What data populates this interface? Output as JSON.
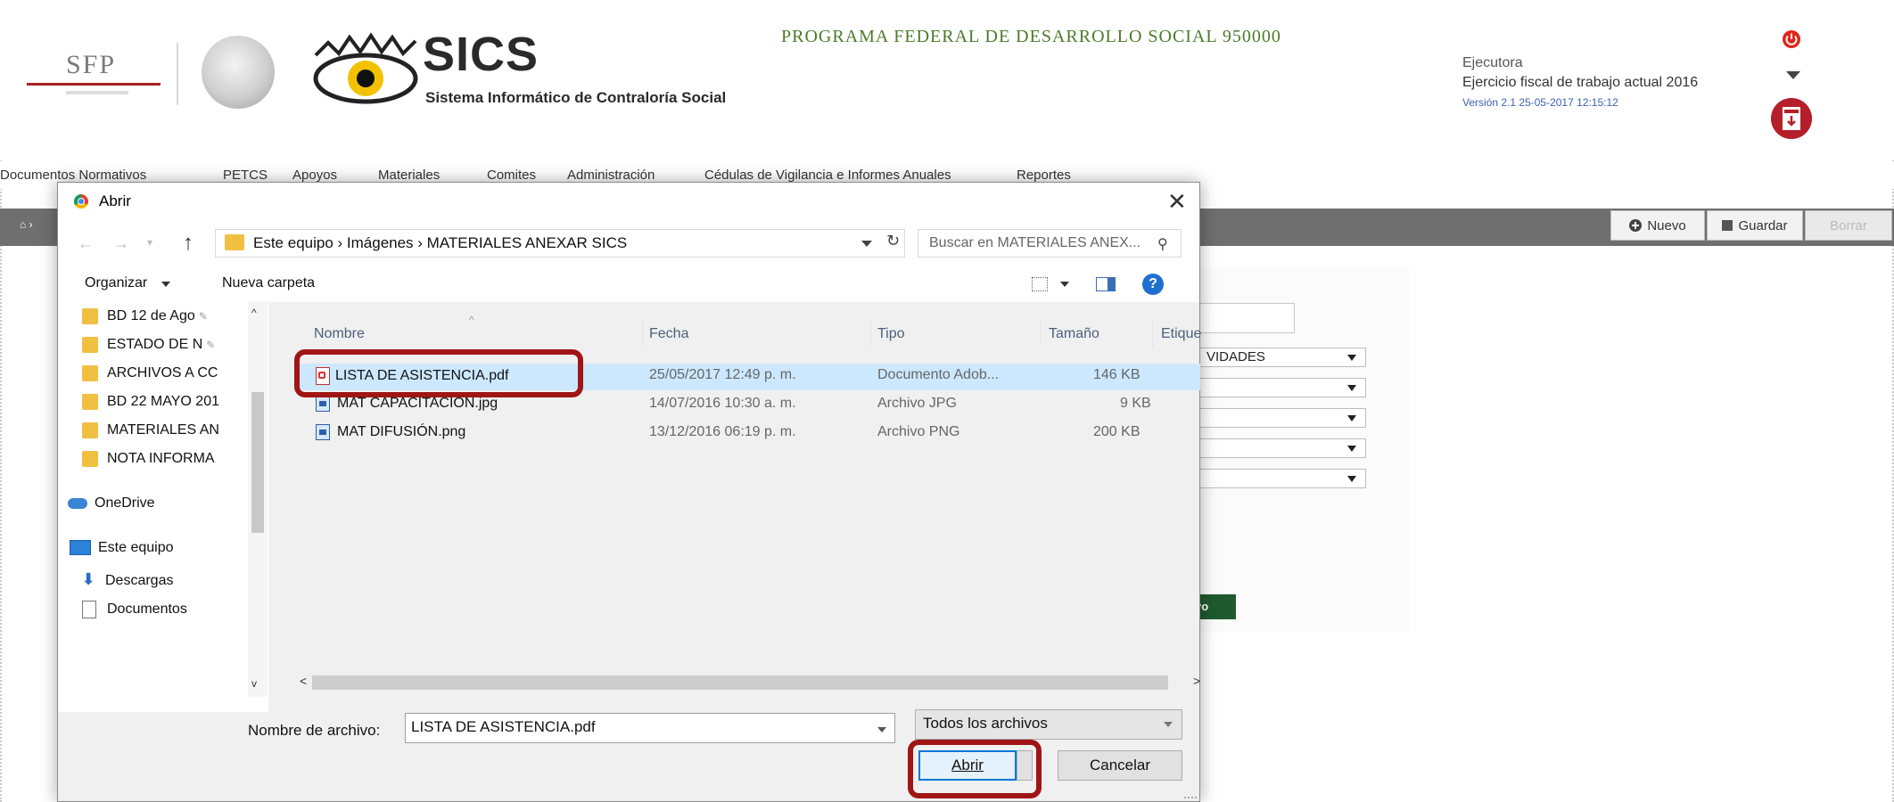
{
  "header": {
    "sfp_logo": "SFP",
    "app_name": "SICS",
    "app_subtitle": "Sistema Informático de Contraloría Social",
    "program_title": "PROGRAMA FEDERAL DE DESARROLLO SOCIAL 950000",
    "role": "Ejecutora",
    "fiscal_year": "Ejercicio fiscal de trabajo actual  2016",
    "version": "Versión 2.1   25-05-2017 12:15:12",
    "icons": [
      "power-icon",
      "caret-down-icon",
      "manual-download-icon"
    ]
  },
  "menu": {
    "items": [
      "Documentos Normativos",
      "PETCS",
      "Apoyos",
      "Materiales",
      "Comites",
      "Administración",
      "Cédulas de Vigilancia e Informes Anuales",
      "Reportes"
    ]
  },
  "toolbar": {
    "new_label": "Nuevo",
    "save_label": "Guardar",
    "delete_label": "Borrar"
  },
  "background_form": {
    "select_1_value": "VIDADES",
    "green_button_label": "vo"
  },
  "dialog": {
    "title": "Abrir",
    "close_symbol": "✕",
    "breadcrumb": "Este equipo  ›  Imágenes  ›  MATERIALES ANEXAR SICS",
    "search_placeholder": "Buscar en MATERIALES ANEX...",
    "organize_label": "Organizar",
    "new_folder_label": "Nueva carpeta",
    "nav_items": [
      "BD 12 de Ago",
      "ESTADO DE N",
      "ARCHIVOS A CC",
      "BD 22 MAYO 201",
      "MATERIALES AN",
      "NOTA INFORMA",
      "OneDrive",
      "Este equipo",
      "Descargas",
      "Documentos"
    ],
    "columns": {
      "name": "Nombre",
      "date": "Fecha",
      "type": "Tipo",
      "size": "Tamaño",
      "tags": "Etique"
    },
    "files": [
      {
        "name": "LISTA DE ASISTENCIA.pdf",
        "date": "25/05/2017 12:49 p. m.",
        "type": "Documento Adob...",
        "size": "146 KB"
      },
      {
        "name": "MAT CAPACITACION.jpg",
        "date": "14/07/2016 10:30 a. m.",
        "type": "Archivo JPG",
        "size": "9 KB"
      },
      {
        "name": "MAT DIFUSIÓN.png",
        "date": "13/12/2016 06:19 p. m.",
        "type": "Archivo PNG",
        "size": "200 KB"
      }
    ],
    "filename_label": "Nombre de archivo:",
    "filename_value": "LISTA DE ASISTENCIA.pdf",
    "filetype_value": "Todos los archivos",
    "open_button": "Abrir",
    "cancel_button": "Cancelar"
  },
  "colors": {
    "highlight": "#a01515",
    "selected_row": "#cce8ff",
    "program_title": "#4c7a2a",
    "primary_button_border": "#0078d7"
  }
}
